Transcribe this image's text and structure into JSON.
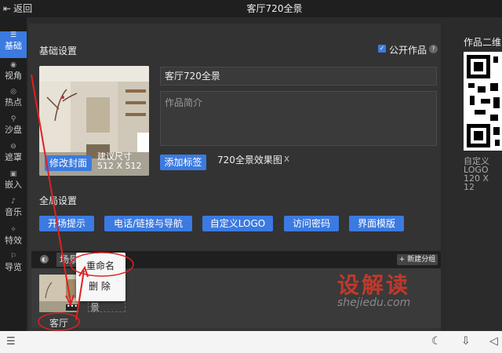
{
  "topbar": {
    "back_label": "返回",
    "title": "客厅720全景"
  },
  "sidebar": {
    "items": [
      {
        "label": "基础",
        "active": true
      },
      {
        "label": "视角"
      },
      {
        "label": "热点"
      },
      {
        "label": "沙盘"
      },
      {
        "label": "遮罩"
      },
      {
        "label": "嵌入"
      },
      {
        "label": "音乐"
      },
      {
        "label": "特效"
      },
      {
        "label": "导览"
      }
    ]
  },
  "basic": {
    "heading": "基础设置",
    "public_label": "公开作品",
    "help_icon": "?",
    "cover_button": "修改封面",
    "cover_hint_1": "建议尺寸",
    "cover_hint_2": "512 X 512",
    "title_value": "客厅720全景",
    "desc_placeholder": "作品简介",
    "add_tag_button": "添加标签",
    "tag_text": "720全景效果图",
    "tag_remove": "x"
  },
  "global": {
    "heading": "全局设置",
    "buttons": [
      "开场提示",
      "电话/链接与导航",
      "自定义LOGO",
      "访问密码",
      "界面模版"
    ]
  },
  "scenes": {
    "group_tab": "场景",
    "new_group_button": "+ 新建分组",
    "scene_name": "客厅",
    "second_label": "景",
    "context_menu": {
      "rename": "重命名",
      "delete": "删 除"
    }
  },
  "right": {
    "qr_title": "作品二维",
    "logo_label_1": "自定义",
    "logo_label_2": "LOGO",
    "logo_label_3": "120 X 12"
  },
  "watermark": {
    "brand": "设解读",
    "url": "shejiedu.com"
  },
  "colors": {
    "accent": "#3b7ae0",
    "annotation_red": "#e02020"
  }
}
